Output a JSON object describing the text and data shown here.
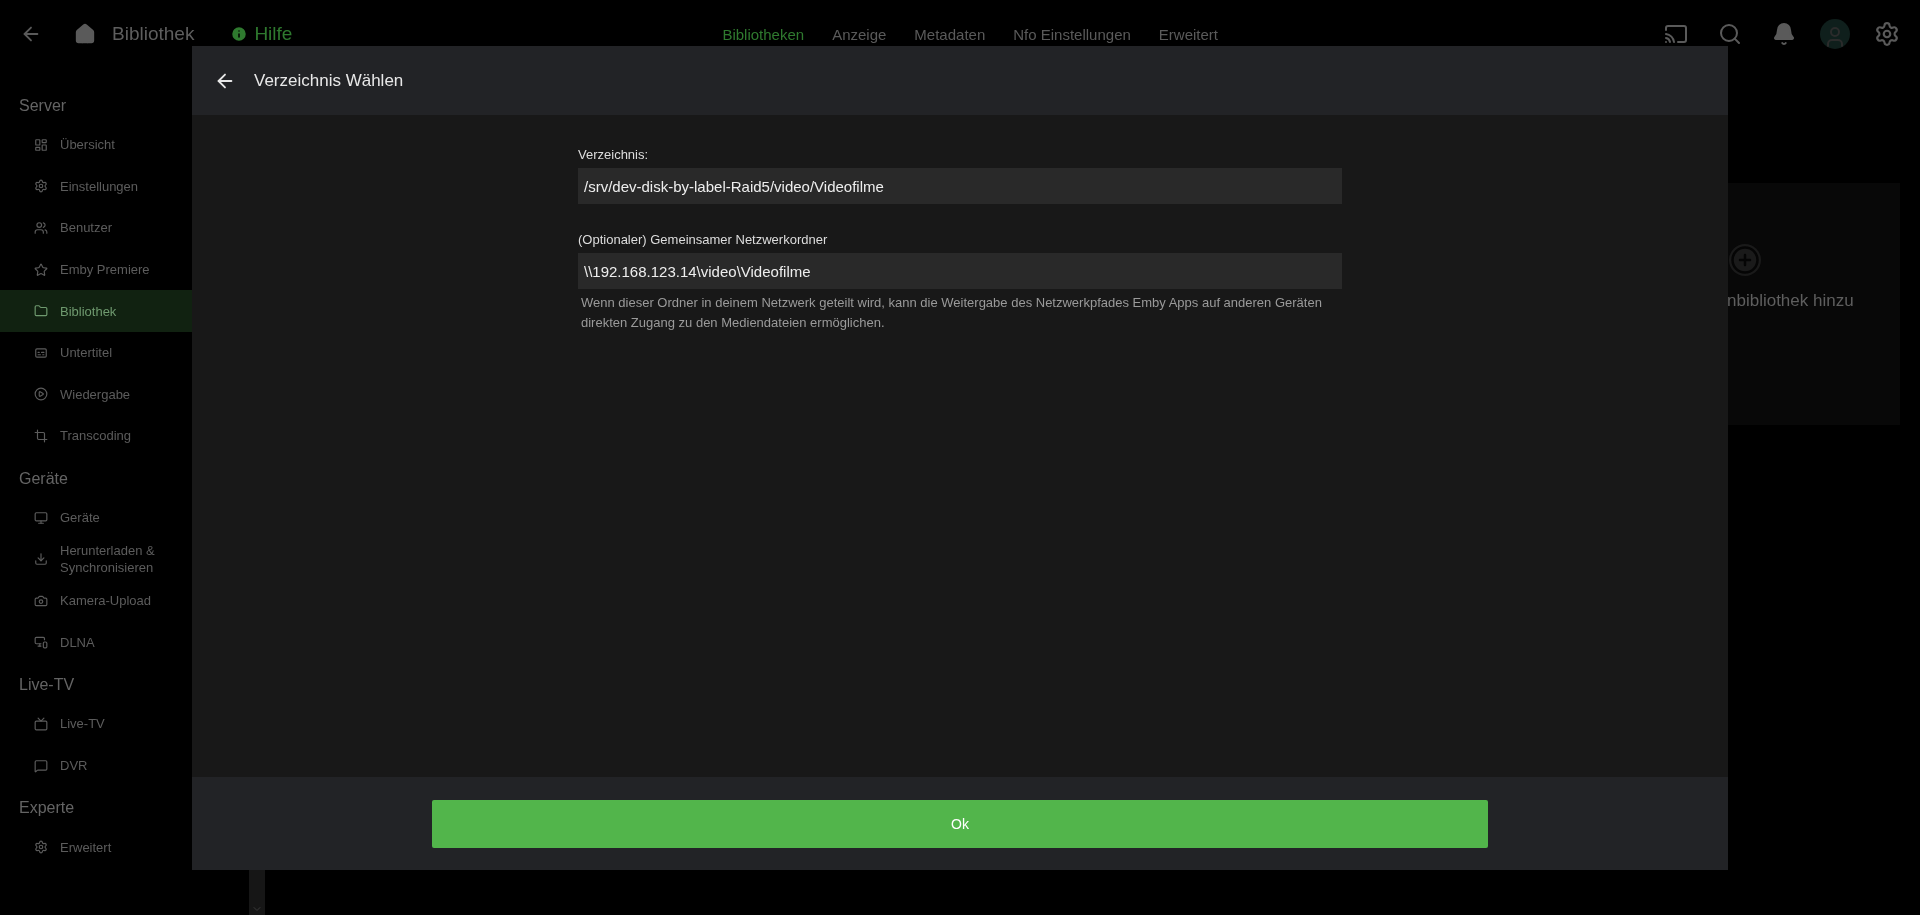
{
  "topbar": {
    "title": "Bibliothek",
    "help": "Hilfe",
    "tabs": [
      {
        "label": "Bibliotheken",
        "selected": true
      },
      {
        "label": "Anzeige",
        "selected": false
      },
      {
        "label": "Metadaten",
        "selected": false
      },
      {
        "label": "Nfo Einstellungen",
        "selected": false
      },
      {
        "label": "Erweitert",
        "selected": false
      }
    ]
  },
  "sidebar": {
    "sections": [
      {
        "title": "Server",
        "items": [
          {
            "label": "Übersicht",
            "selected": false
          },
          {
            "label": "Einstellungen",
            "selected": false
          },
          {
            "label": "Benutzer",
            "selected": false
          },
          {
            "label": "Emby Premiere",
            "selected": false
          },
          {
            "label": "Bibliothek",
            "selected": true
          },
          {
            "label": "Untertitel",
            "selected": false
          },
          {
            "label": "Wiedergabe",
            "selected": false
          },
          {
            "label": "Transcoding",
            "selected": false
          }
        ]
      },
      {
        "title": "Geräte",
        "items": [
          {
            "label": "Geräte",
            "selected": false
          },
          {
            "label": "Herunterladen & Synchronisieren",
            "selected": false
          },
          {
            "label": "Kamera-Upload",
            "selected": false
          },
          {
            "label": "DLNA",
            "selected": false
          }
        ]
      },
      {
        "title": "Live-TV",
        "items": [
          {
            "label": "Live-TV",
            "selected": false
          },
          {
            "label": "DVR",
            "selected": false
          }
        ]
      },
      {
        "title": "Experte",
        "items": [
          {
            "label": "Erweitert",
            "selected": false
          }
        ]
      }
    ]
  },
  "library_card": {
    "label": "nbibliothek hinzu"
  },
  "dialog": {
    "title": "Verzeichnis Wählen",
    "fields": [
      {
        "label": "Verzeichnis:",
        "value": "/srv/dev-disk-by-label-Raid5/video/Videofilme"
      },
      {
        "label": "(Optionaler) Gemeinsamer Netzwerkordner",
        "value": "\\\\192.168.123.14\\video\\Videofilme",
        "help": "Wenn dieser Ordner in deinem Netzwerk geteilt wird, kann die Weitergabe des Netzwerkpfades Emby Apps auf anderen Geräten direkten Zugang zu den Mediendateien ermöglichen."
      }
    ],
    "button": "Ok"
  }
}
